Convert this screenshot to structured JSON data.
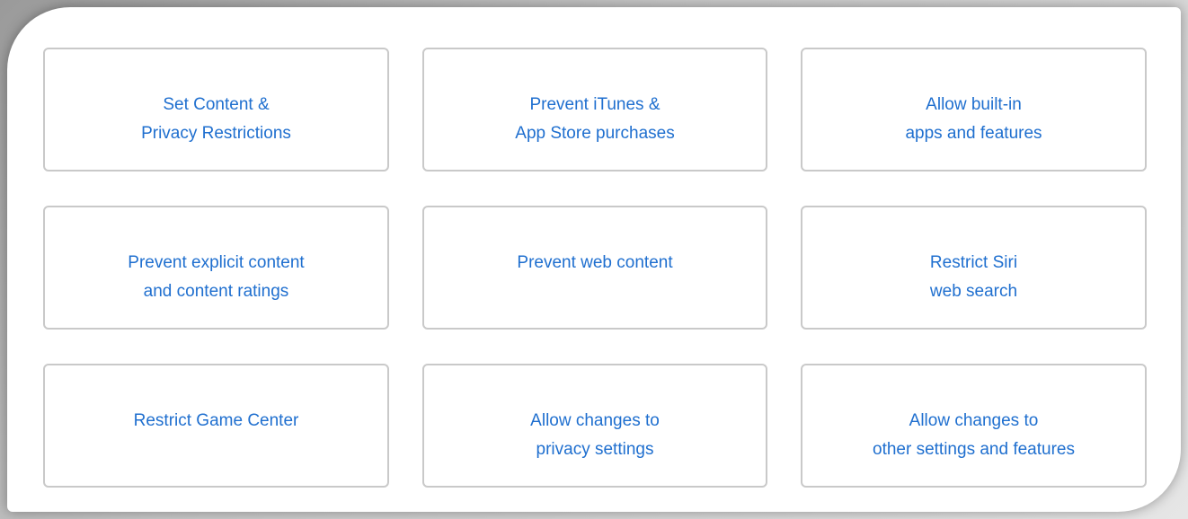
{
  "cards": [
    {
      "label": "Set Content &\nPrivacy Restrictions"
    },
    {
      "label": "Prevent iTunes &\nApp Store purchases"
    },
    {
      "label": "Allow built-in\napps and features"
    },
    {
      "label": "Prevent explicit content\nand content ratings"
    },
    {
      "label": "Prevent web content"
    },
    {
      "label": "Restrict Siri\nweb search"
    },
    {
      "label": "Restrict Game Center"
    },
    {
      "label": "Allow changes to\nprivacy settings"
    },
    {
      "label": "Allow changes to\nother settings and features"
    }
  ]
}
